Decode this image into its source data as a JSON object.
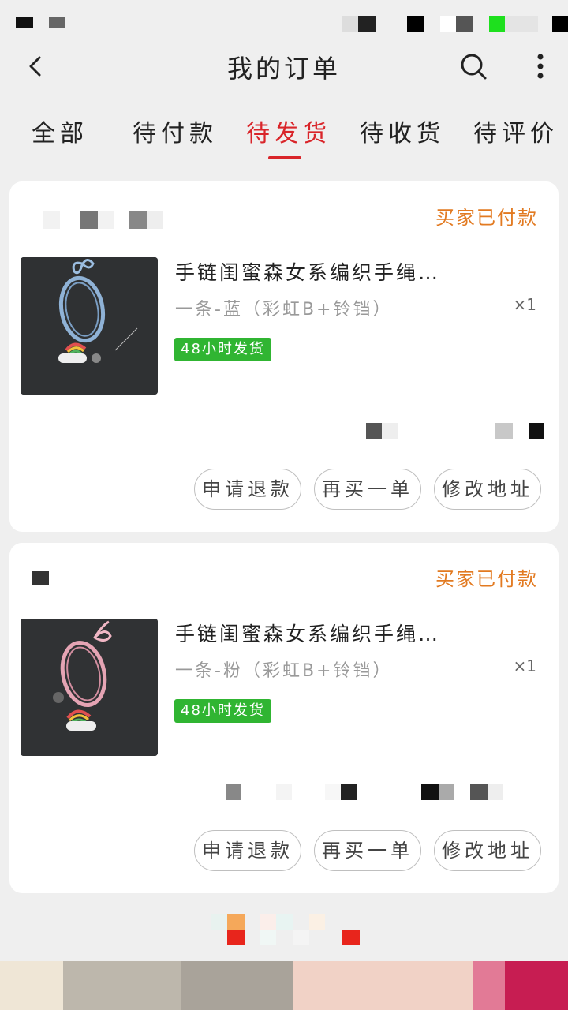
{
  "header": {
    "title": "我的订单",
    "back_icon": "chevron-left-icon",
    "search_icon": "search-icon",
    "more_icon": "more-vertical-icon"
  },
  "tabs": [
    {
      "label": "全部",
      "active": false
    },
    {
      "label": "待付款",
      "active": false
    },
    {
      "label": "待发货",
      "active": true
    },
    {
      "label": "待收货",
      "active": false
    },
    {
      "label": "待评价",
      "active": false
    }
  ],
  "colors": {
    "accent": "#d9252a",
    "status": "#e27a21",
    "badge": "#30b532",
    "background": "#efefef"
  },
  "orders": [
    {
      "status": "买家已付款",
      "product_title": "手链闺蜜森女系编织手绳…",
      "variant": "一条-蓝（彩虹B+铃铛）",
      "quantity": "×1",
      "badge": "48小时发货",
      "thumbnail": "blue-braided-bracelet",
      "buttons": {
        "refund": "申请退款",
        "rebuy": "再买一单",
        "address": "修改地址"
      }
    },
    {
      "status": "买家已付款",
      "product_title": "手链闺蜜森女系编织手绳…",
      "variant": "一条-粉（彩虹B+铃铛）",
      "quantity": "×1",
      "badge": "48小时发货",
      "thumbnail": "pink-braided-bracelet",
      "buttons": {
        "refund": "申请退款",
        "rebuy": "再买一单",
        "address": "修改地址"
      }
    }
  ]
}
